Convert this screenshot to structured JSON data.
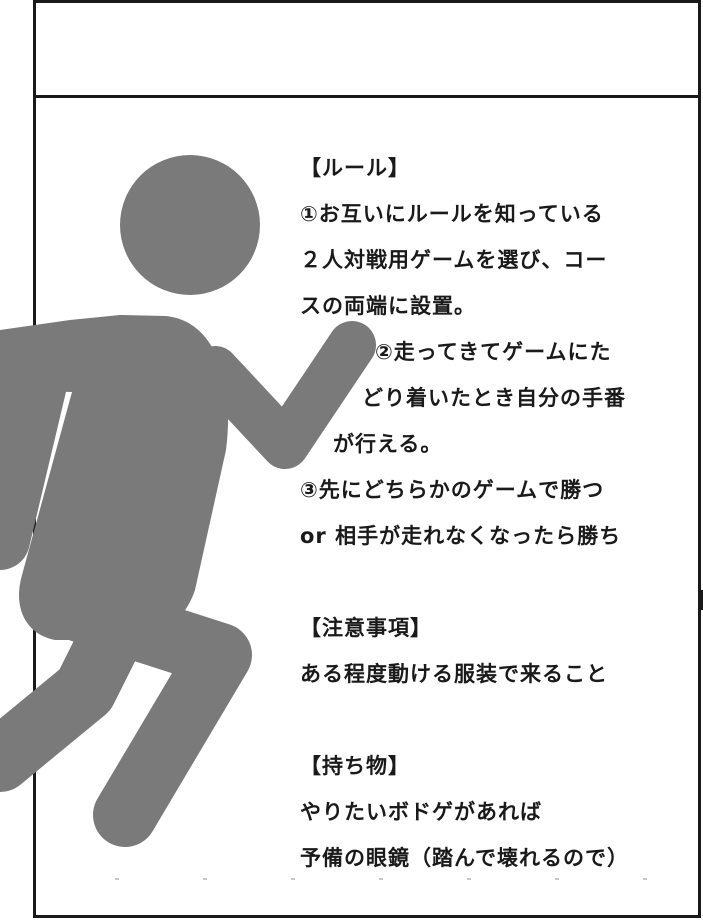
{
  "rules": {
    "heading": "【ルール】",
    "lines": [
      "①お互いにルールを知っている",
      "２人対戦用ゲームを選び、コー",
      "スの両端に設置。",
      "②走ってきてゲームにた",
      "どり着いたとき自分の手番",
      "が行える。",
      "③先にどちらかのゲームで勝つ",
      "or 相手が走れなくなったら勝ち"
    ]
  },
  "notes": {
    "heading": "【注意事項】",
    "lines": [
      "ある程度動ける服装で来ること"
    ]
  },
  "belongings": {
    "heading": "【持ち物】",
    "lines": [
      "やりたいボドゲがあれば",
      "予備の眼鏡（踏んで壊れるので）"
    ]
  },
  "colors": {
    "figure": "#7a7a7a",
    "text": "#1a1a1a",
    "border": "#1a1a1a"
  },
  "figure_icon": "running-person-icon"
}
